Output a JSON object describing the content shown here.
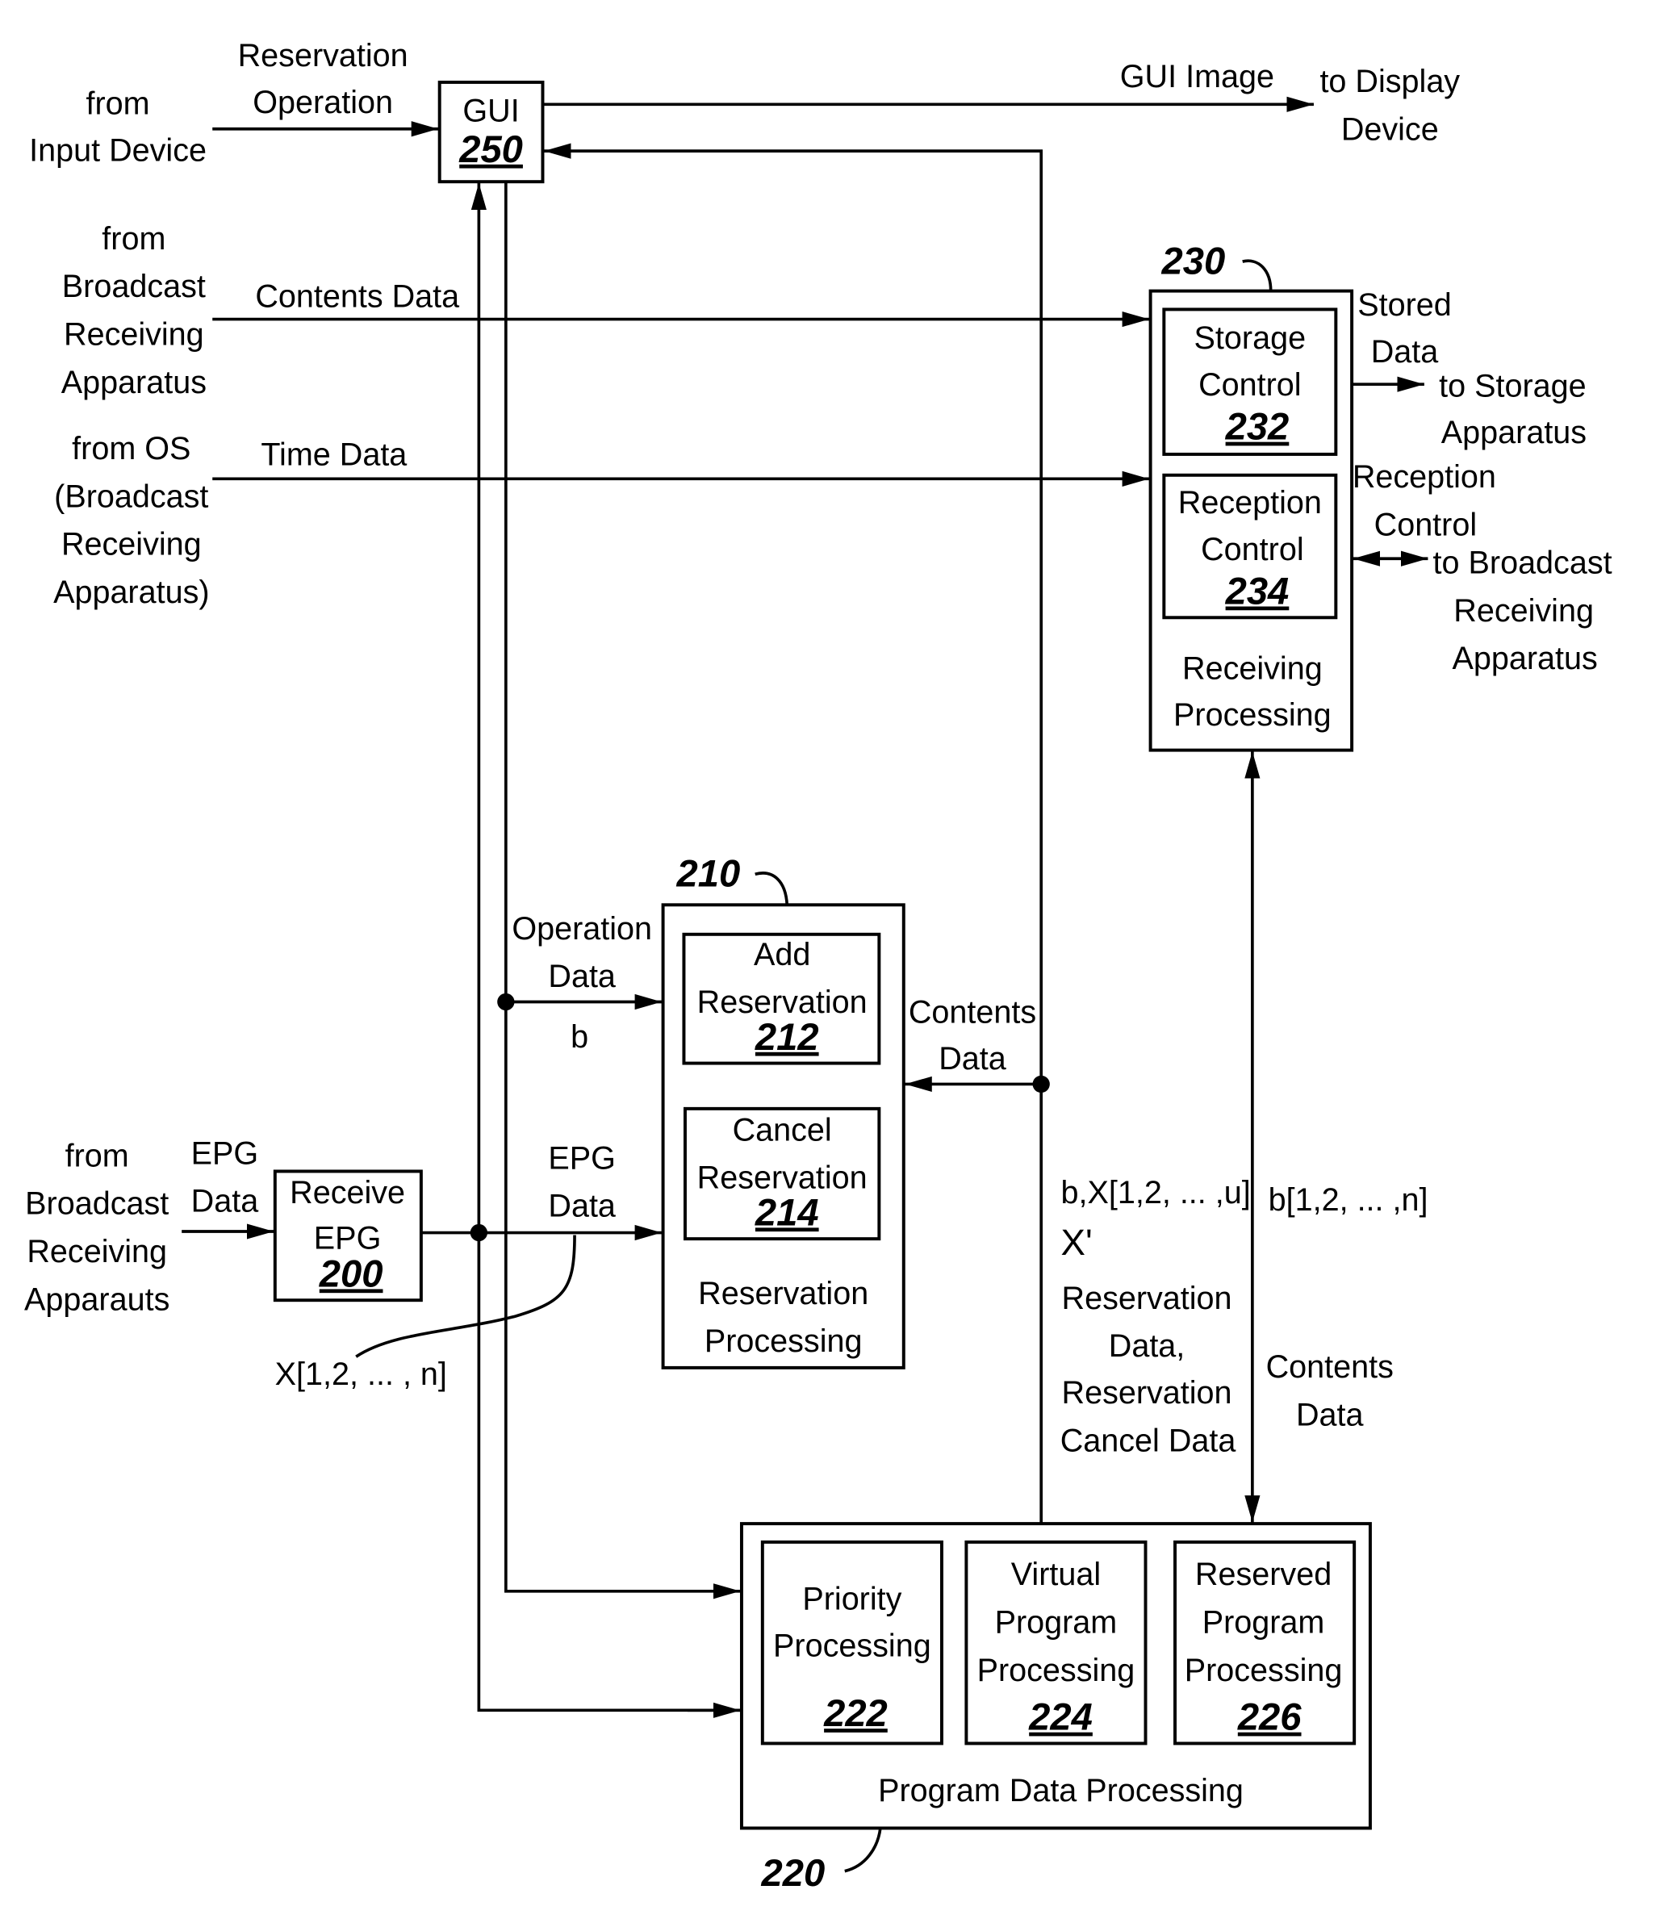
{
  "diagram": {
    "external": {
      "from_input_device": [
        "from",
        "Input Device"
      ],
      "reservation_operation": [
        "Reservation",
        "Operation"
      ],
      "gui_image": "GUI Image",
      "to_display_device": [
        "to Display",
        "Device"
      ],
      "from_broadcast_1": [
        "from",
        "Broadcast",
        "Receiving",
        "Apparatus"
      ],
      "contents_data_top": "Contents Data",
      "from_os": [
        "from OS",
        "(Broadcast",
        "Receiving",
        "Apparatus)"
      ],
      "time_data": "Time Data",
      "stored_data": [
        "Stored",
        "Data"
      ],
      "to_storage": [
        "to Storage",
        "Apparatus"
      ],
      "reception_control": [
        "Reception",
        "Control"
      ],
      "to_broadcast": [
        "to Broadcast",
        "Receiving",
        "Apparatus"
      ],
      "from_broadcast_2": [
        "from",
        "Broadcast",
        "Receiving",
        "Apparauts"
      ],
      "epg_data_in": [
        "EPG",
        "Data"
      ],
      "operation_data": [
        "Operation",
        "Data"
      ],
      "b": "b",
      "epg_data_mid": [
        "EPG",
        "Data"
      ],
      "x_list": "X[1,2, ... , n]",
      "contents_data_mid": [
        "Contents",
        "Data"
      ],
      "bx_list": "b,X[1,2, ... ,u]",
      "x_prime": "X'",
      "reservation_data": [
        "Reservation",
        "Data,",
        "Reservation",
        "Cancel Data"
      ],
      "b_list": "b[1,2, ... ,n]",
      "contents_data_low": [
        "Contents",
        "Data"
      ]
    },
    "blocks": {
      "gui": {
        "label": "GUI",
        "ref": "250"
      },
      "receiving": {
        "label": [
          "Receiving",
          "Processing"
        ],
        "ref": "230"
      },
      "storage_control": {
        "label": [
          "Storage",
          "Control"
        ],
        "ref": "232"
      },
      "reception_control": {
        "label": [
          "Reception",
          "Control"
        ],
        "ref": "234"
      },
      "reservation": {
        "label": [
          "Reservation",
          "Processing"
        ],
        "ref": "210"
      },
      "add_reservation": {
        "label": [
          "Add",
          "Reservation"
        ],
        "ref": "212"
      },
      "cancel_reservation": {
        "label": [
          "Cancel",
          "Reservation"
        ],
        "ref": "214"
      },
      "receive_epg": {
        "label": [
          "Receive",
          "EPG"
        ],
        "ref": "200"
      },
      "program_data": {
        "label": "Program Data Processing",
        "ref": "220"
      },
      "priority": {
        "label": [
          "Priority",
          "Processing"
        ],
        "ref": "222"
      },
      "virtual": {
        "label": [
          "Virtual",
          "Program",
          "Processing"
        ],
        "ref": "224"
      },
      "reserved": {
        "label": [
          "Reserved",
          "Program",
          "Processing"
        ],
        "ref": "226"
      }
    }
  }
}
